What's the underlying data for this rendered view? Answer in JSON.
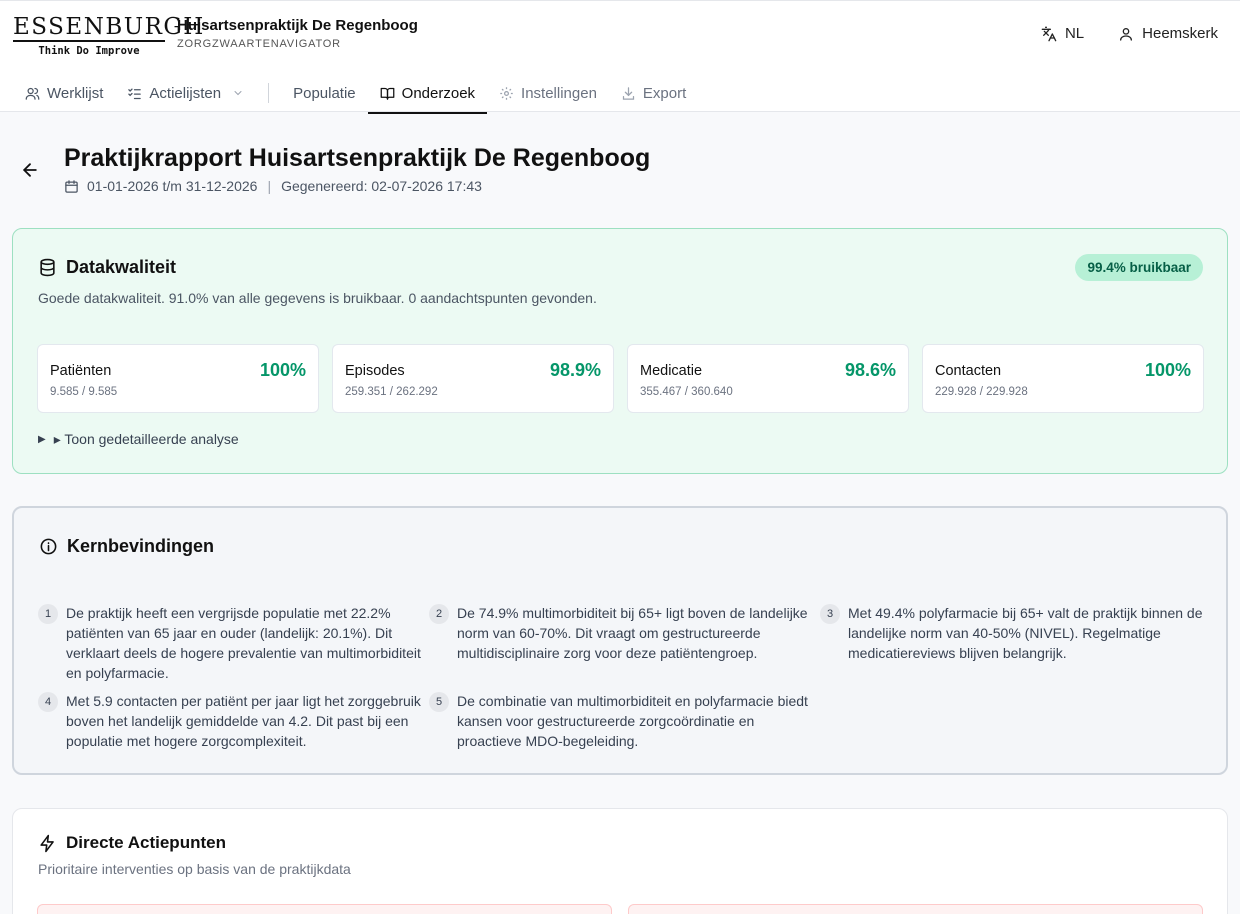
{
  "logo": {
    "name": "ESSENBURGH",
    "tagline": "Think Do Improve"
  },
  "practice": {
    "name": "Huisartsenpraktijk De Regenboog",
    "subtitle": "ZORGZWAARTENAVIGATOR"
  },
  "topbar": {
    "language": "NL",
    "user": "Heemskerk"
  },
  "nav": [
    {
      "label": "Werklijst",
      "icon": "users-icon"
    },
    {
      "label": "Actielijsten",
      "icon": "list-checks-icon"
    },
    {
      "label": "Populatie"
    },
    {
      "label": "Onderzoek",
      "icon": "book-open-icon"
    },
    {
      "label": "Instellingen",
      "icon": "gear-icon"
    },
    {
      "label": "Export",
      "icon": "download-icon"
    }
  ],
  "report": {
    "title": "Praktijkrapport Huisartsenpraktijk De Regenboog",
    "period": "01-01-2026 t/m 31-12-2026",
    "generated": "Gegenereerd: 02-07-2026 17:43"
  },
  "data_quality": {
    "title": "Datakwaliteit",
    "badge": "99.4% bruikbaar",
    "description": "Goede datakwaliteit. 91.0% van alle gegevens is bruikbaar. 0 aandachtspunten gevonden.",
    "stats": [
      {
        "label": "Patiënten",
        "count": "9.585 / 9.585",
        "value": "100%"
      },
      {
        "label": "Episodes",
        "count": "259.351 / 262.292",
        "value": "98.9%"
      },
      {
        "label": "Medicatie",
        "count": "355.467 / 360.640",
        "value": "98.6%"
      },
      {
        "label": "Contacten",
        "count": "229.928 / 229.928",
        "value": "100%"
      }
    ],
    "details_label": "▸ Toon gedetailleerde analyse",
    "accent": "#059669"
  },
  "findings": {
    "title": "Kernbevindingen",
    "items": [
      {
        "num": "1",
        "text": "De praktijk heeft een vergrijsde populatie met 22.2% patiënten van 65 jaar en ouder (landelijk: 20.1%). Dit verklaart deels de hogere prevalentie van multimorbiditeit en polyfarmacie."
      },
      {
        "num": "2",
        "text": "De 74.9% multimorbiditeit bij 65+ ligt boven de landelijke norm van 60-70%. Dit vraagt om gestructureerde multidisciplinaire zorg voor deze patiëntengroep."
      },
      {
        "num": "3",
        "text": "Met 49.4% polyfarmacie bij 65+ valt de praktijk binnen de landelijke norm van 40-50% (NIVEL). Regelmatige medicatiereviews blijven belangrijk."
      },
      {
        "num": "4",
        "text": "Met 5.9 contacten per patiënt per jaar ligt het zorggebruik boven het landelijk gemiddelde van 4.2. Dit past bij een populatie met hogere zorgcomplexiteit."
      },
      {
        "num": "5",
        "text": "De combinatie van multimorbiditeit en polyfarmacie biedt kansen voor gestructureerde zorgcoördinatie en proactieve MDO-begeleiding."
      }
    ]
  },
  "actions": {
    "title": "Directe Actiepunten",
    "description": "Prioritaire interventies op basis van de praktijkdata"
  }
}
